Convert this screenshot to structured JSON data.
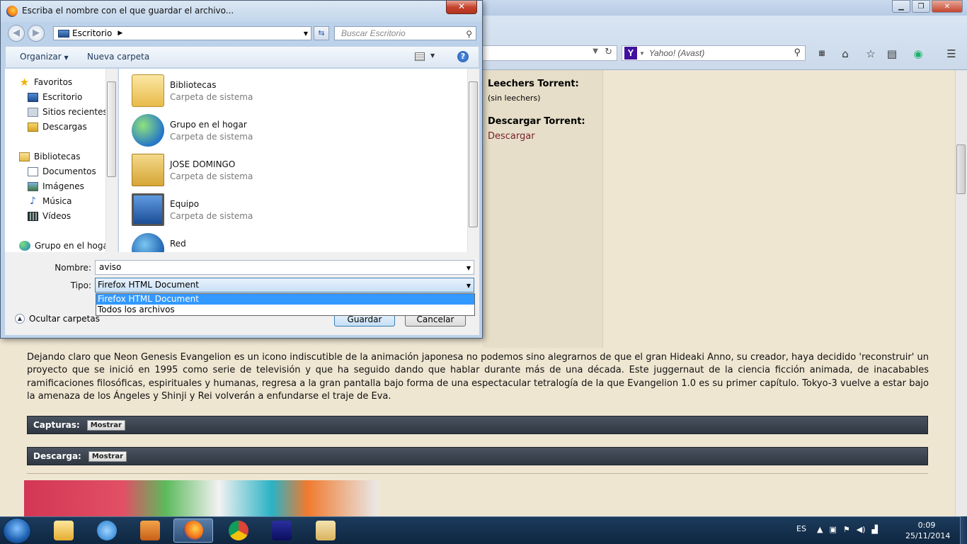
{
  "browser": {
    "search_placeholder": "Yahoo! (Avast)"
  },
  "page": {
    "leechers_label": "Leechers Torrent:",
    "leechers_value": "(sin leechers)",
    "download_label": "Descargar Torrent:",
    "download_link": "Descargar",
    "description": "Dejando claro que Neon Genesis Evangelion es un icono indiscutible de la animación japonesa no podemos sino alegrarnos de que el gran Hideaki Anno, su creador, haya decidido 'reconstruir' un proyecto que se inició en 1995 como serie de televisión y que ha seguido dando que hablar durante más de una década. Este juggernaut de la ciencia ficción animada, de inacabables ramificaciones filosóficas, espirituales y humanas, regresa a la gran pantalla bajo forma de una espectacular tetralogía de la que Evangelion 1.0 es su primer capítulo. Tokyo-3 vuelve a estar bajo la amenaza de los Ángeles y Shinji y Rei volverán a enfundarse el traje de Eva.",
    "captures_label": "Capturas:",
    "captures_button": "Mostrar",
    "download_bar_label": "Descarga:",
    "download_bar_button": "Mostrar"
  },
  "dialog": {
    "title": "Escriba el nombre con el que guardar el archivo...",
    "close": "✕",
    "address": "Escritorio",
    "search_placeholder": "Buscar Escritorio",
    "organize": "Organizar",
    "new_folder": "Nueva carpeta",
    "nav": {
      "favorites": "Favoritos",
      "desktop": "Escritorio",
      "recent": "Sitios recientes",
      "downloads": "Descargas",
      "libraries": "Bibliotecas",
      "documents": "Documentos",
      "images": "Imágenes",
      "music": "Música",
      "videos": "Vídeos",
      "homegroup": "Grupo en el hogar"
    },
    "files": [
      {
        "name": "Bibliotecas",
        "type": "Carpeta de sistema"
      },
      {
        "name": "Grupo en el hogar",
        "type": "Carpeta de sistema"
      },
      {
        "name": "JOSE DOMINGO",
        "type": "Carpeta de sistema"
      },
      {
        "name": "Equipo",
        "type": "Carpeta de sistema"
      },
      {
        "name": "Red",
        "type": ""
      }
    ],
    "name_label": "Nombre:",
    "name_value": "aviso",
    "type_label": "Tipo:",
    "type_value": "Firefox HTML Document",
    "type_options": [
      "Firefox HTML Document",
      "Todos los archivos"
    ],
    "save_button": "Guardar",
    "cancel_button": "Cancelar",
    "hide_folders": "Ocultar carpetas"
  },
  "taskbar": {
    "language": "ES",
    "time": "0:09",
    "date": "25/11/2014"
  },
  "colors": {
    "page_bg": "#efe6d2",
    "link": "#7a1f2b",
    "bar_bg": "#323a45",
    "selection": "#3399ff"
  }
}
